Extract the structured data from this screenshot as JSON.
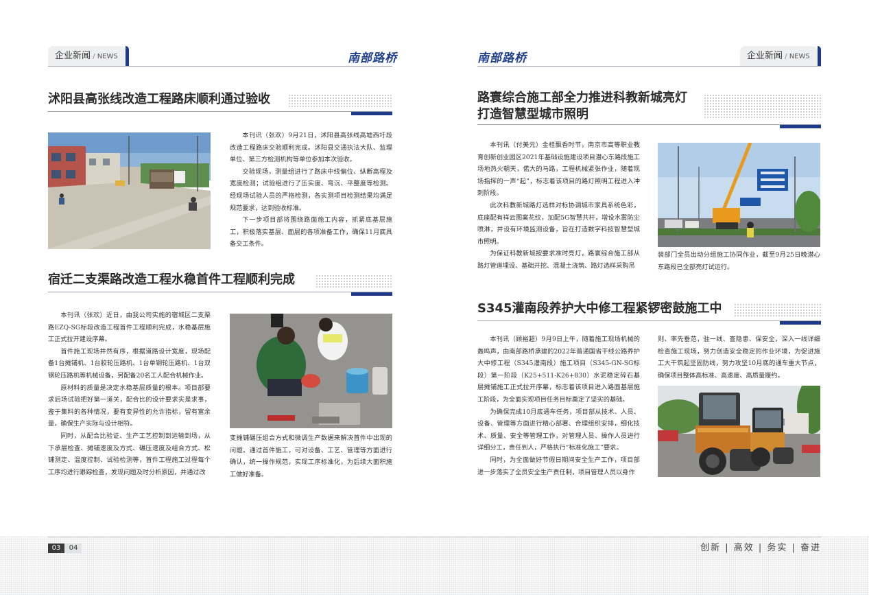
{
  "header": {
    "section_cn": "企业新闻",
    "section_sep": " / ",
    "section_en": "NEWS",
    "brand": "南部路桥"
  },
  "articles": [
    {
      "title": "沭阳县高张线改造工程路床顺利通过验收",
      "paragraphs": [
        "本刊讯（张欢）9月21日，沭阳县高张线高墟西圩段改造工程路床交验顺利完成。沭阳县交通执法大队、监理单位、第三方检测机构等单位参加本次验收。",
        "交验现场，测量组进行了路床中线偏位、纵断高程及宽度检测；试验组进行了压实度、弯沉、平整度等检测。经现场试验人员的严格检测，各实测项目检测结果均满足规范要求，达到验收标准。",
        "下一步项目部将围绕路面施工内容，抓紧底基层施工，积极落实基层、面层的各项准备工作，确保11月底具备交工条件。"
      ]
    },
    {
      "title": "宿迁二支渠路改造工程水稳首件工程顺利完成",
      "paragraphs_left": [
        "本刊讯（张欢）近日，由我公司实施的宿城区二支渠路EZQ-SG标段改造工程首件工程顺利完成，水稳基层施工正式拉开建设序幕。",
        "首件施工现场井然有序，根据道路设计宽度，现场配备1台摊铺机、1台胶轮压路机、1台单钢轮压路机、1台双钢轮压路机等机械设备，另配备20名工人配合机械作业。",
        "原材料的质量是决定水稳基层质量的根本。项目部要求后场试验把好第一道关，配合比的设计要求实是求事，鉴于集料的各种情况，要有变异性的允许指标，留有富余量，确保生产实际与设计相符。",
        "同时，从配合比验证、生产工艺控制到运输到场，从下承层检查、摊铺速度及方式、碾压速度及组合方式、松铺测定、温度控制、试验检测等，首件工程施工过程每个工序均进行跟踪检查，发现问题及时分析原因，并通过改"
      ],
      "paragraphs_right": [
        "变摊铺碾压组合方式和微调生产数据来解决首件中出现的问题。通过首件施工，可对设备、工艺、管理等方面进行确认，统一操作规范，实现工序标准化，为后续大面积施工做好准备。"
      ]
    },
    {
      "title_line1": "路寰综合施工部全力推进科教新城亮灯",
      "title_line2": "打造智慧型城市照明",
      "paragraphs_left": [
        "本刊讯（付美元）金桂飘香时节，南京市高等职业教育创新创业园区2021年基础设施建设项目潜心东路段施工场地热火朝天，偌大的马路，工程机械紧张作业，随着现场指挥的一声“起”，标志着该项目的路灯照明工程进入冲刺阶段。",
        "此次科教新城路灯选样对标协调城市家具系统色彩，底座配有祥云图案花纹，加配5G智慧共杆，增设水雾防尘喷淋，并设有环境监测设备，旨在打造数字科技智慧型城市照明。",
        "为保证科教新城按要求准时亮灯，路寰综合施工部从路灯管道埋设、基础开挖、混凝土浇筑、路灯选样采购吊"
      ],
      "paragraphs_right": [
        "装部门全员出动分组施工协同作业，截至9月25日晚潜心东路段已全部亮灯试运行。"
      ]
    },
    {
      "title": "S345灌南段养护大中修工程紧锣密鼓施工中",
      "paragraphs_left": [
        "本刊讯（顾裕超）9月9日上午，随着施工现场机械的轰鸣声，由南部路桥承建的2022年普通国省干线公路养护大中修工程（S345灌南段）施工项目（S345-GN-SG标段）第一阶段（K25+511-K26+830）水泥稳定碎石基层摊铺施工正式拉开序幕，标志着该项目进入路面基层施工阶段，为全面实现项目任务目标奠定了坚实的基础。",
        "为确保完成10月底通车任务，项目部从技术、人员、设备、管理等方面进行精心部署、合理组织安排，细化技术、质量、安全等管理工作，对管理人员、操作人员进行详细分工，责任到人，严格执行“标准化施工”要求。",
        "同时，为全面做好节假日期间安全生产工作，项目部进一步落实了全员安全生产责任制，项目管理人员以身作"
      ],
      "paragraphs_right": [
        "则、率先垂范，驻一线、查隐患、保安全，深入一线详细检查施工现场，努力创造安全稳定的作业环境，为促进施工大干筑起坚固防线，努力攻坚10月底的通车重大节点，确保项目整体高标准、高速度、高质量履约。"
      ]
    }
  ],
  "footer": {
    "page_left": "03",
    "page_right": "04",
    "slogan": "创新 | 高效 | 务实 | 奋进"
  }
}
